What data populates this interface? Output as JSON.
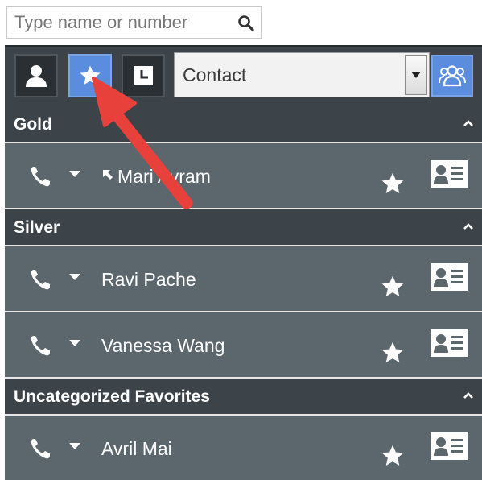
{
  "search": {
    "placeholder": "Type name or number"
  },
  "toolbar": {
    "buttons": [
      {
        "icon": "person-icon",
        "active": false
      },
      {
        "icon": "star-icon",
        "active": true
      },
      {
        "icon": "clock-icon",
        "active": false
      }
    ],
    "filter_dropdown": {
      "selected": "Contact"
    },
    "team_button_icon": "group-icon"
  },
  "sections": [
    {
      "title": "Gold",
      "contacts": [
        {
          "name": "Mari Avram",
          "status_icon": "away-arrow-icon"
        }
      ]
    },
    {
      "title": "Silver",
      "contacts": [
        {
          "name": "Ravi Pache"
        },
        {
          "name": "Vanessa Wang"
        }
      ]
    },
    {
      "title": "Uncategorized Favorites",
      "contacts": [
        {
          "name": "Avril Mai"
        }
      ]
    }
  ],
  "colors": {
    "panel_bg": "#3d4449",
    "row_bg": "#5c666d",
    "active_button": "#5b8dde",
    "annotation_arrow": "#e8413c"
  }
}
